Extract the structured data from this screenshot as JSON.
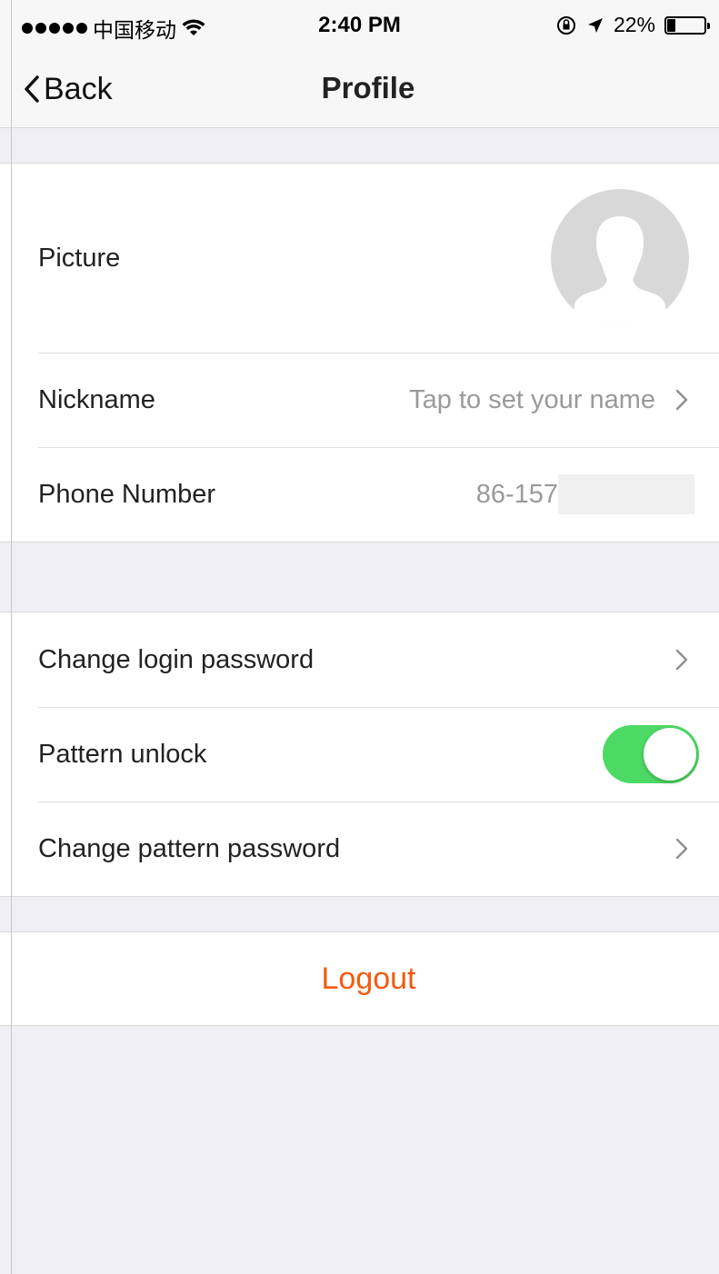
{
  "status_bar": {
    "carrier": "中国移动",
    "time": "2:40 PM",
    "battery_text": "22%",
    "battery_level": 0.22
  },
  "nav": {
    "back_label": "Back",
    "title": "Profile"
  },
  "profile": {
    "picture_label": "Picture",
    "nickname_label": "Nickname",
    "nickname_value": "Tap to set your name",
    "phone_label": "Phone Number",
    "phone_value": "86-157"
  },
  "security": {
    "change_login_password_label": "Change login password",
    "pattern_unlock_label": "Pattern unlock",
    "pattern_unlock_enabled": true,
    "change_pattern_password_label": "Change pattern password"
  },
  "logout_label": "Logout",
  "colors": {
    "accent": "#f35b11",
    "toggle_on": "#4cd964",
    "background": "#efeff4"
  }
}
